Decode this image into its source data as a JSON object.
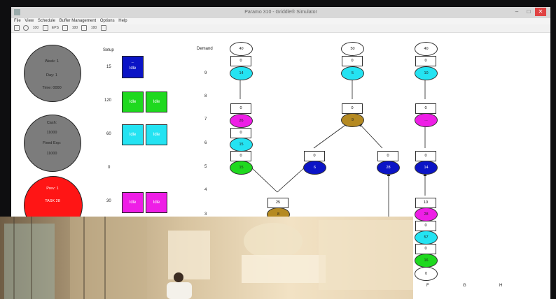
{
  "window": {
    "title": "Paramo 310 - Griddle® Simulator"
  },
  "menu": [
    "File",
    "View",
    "Schedule",
    "Buffer Management",
    "Options",
    "Help"
  ],
  "toolbar": {
    "items": [
      "100",
      "EPS",
      "100",
      "100"
    ]
  },
  "info": {
    "week": "Week: 1",
    "day": "Day: 1",
    "time": "Time: 0000",
    "cash": "Cash:",
    "cash_value": "11000",
    "fixed_exp": "Fixed Exp:",
    "fixed_exp_value": "11000",
    "prev": "Prev: 1",
    "prev_value": "TASK 28"
  },
  "setup": {
    "header": "Setup",
    "values": [
      "15",
      "120",
      "60",
      "0",
      "30"
    ]
  },
  "machines": {
    "blue": {
      "name": "...",
      "state": "Idle"
    },
    "green": [
      "Idle",
      "Idle"
    ],
    "cyan": [
      "Idle",
      "Idle"
    ],
    "magenta": [
      "Idle",
      "Idle"
    ]
  },
  "demand": {
    "header": "Demand",
    "levels": [
      "9",
      "8",
      "7",
      "6",
      "5",
      "4",
      "3"
    ]
  },
  "flow": {
    "colA": {
      "top": "40",
      "buf1": "0",
      "n1": "14",
      "buf2": "0",
      "n2": "26",
      "buf3": "0",
      "n3": "15",
      "buf4": "0",
      "n4": "15"
    },
    "colB": {
      "top": "50",
      "buf1": "0",
      "n1": "5",
      "buf2": "0",
      "n2": "9",
      "buf3a": "0",
      "n3a": "6",
      "buf3b": "0",
      "n3b": "28"
    },
    "colC": {
      "top": "40",
      "buf1": "0",
      "n1": "10",
      "buf2": "0",
      "n2": "...",
      "buf3": "0",
      "n3": "14",
      "buf4": "10",
      "n4": "28",
      "buf5": "0",
      "n5": "57",
      "buf6": "0",
      "n6": "16",
      "buf7": "0",
      "n7": "0"
    },
    "center": {
      "buf": "25",
      "n": "8"
    }
  },
  "colors": {
    "gray": "#7c7c7c",
    "red": "#ff1515",
    "blue": "#0b14c6",
    "green": "#1fd91f",
    "cyan": "#24e3f2",
    "magenta": "#ee1ee6",
    "gold": "#b58a22"
  },
  "bottom_labels": [
    "F",
    "G",
    "H"
  ]
}
